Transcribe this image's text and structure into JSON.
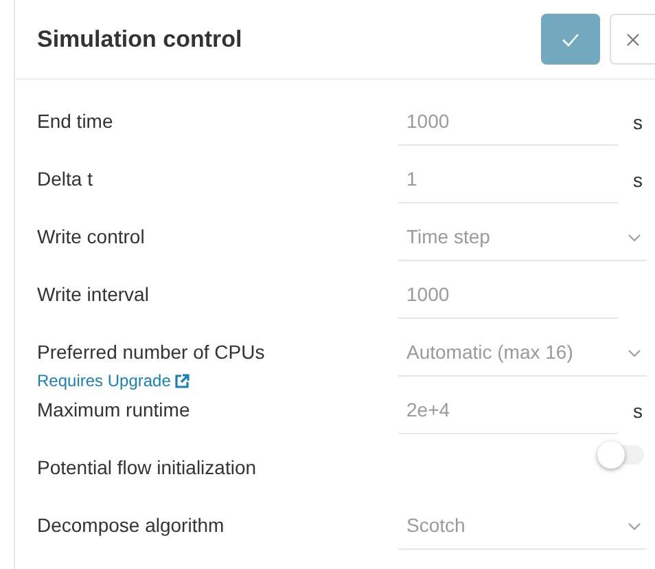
{
  "panel": {
    "title": "Simulation control"
  },
  "fields": [
    {
      "kind": "input",
      "label": "End time",
      "value": "1000",
      "unit": "s"
    },
    {
      "kind": "input",
      "label": "Delta t",
      "value": "1",
      "unit": "s"
    },
    {
      "kind": "select",
      "label": "Write control",
      "value": "Time step"
    },
    {
      "kind": "input",
      "label": "Write interval",
      "value": "1000"
    },
    {
      "kind": "select",
      "label": "Preferred number of CPUs",
      "value": "Automatic (max 16)",
      "link": "Requires Upgrade"
    },
    {
      "kind": "input",
      "label": "Maximum runtime",
      "value": "2e+4",
      "unit": "s"
    },
    {
      "kind": "toggle",
      "label": "Potential flow initialization",
      "on": false
    },
    {
      "kind": "select",
      "label": "Decompose algorithm",
      "value": "Scotch"
    }
  ]
}
